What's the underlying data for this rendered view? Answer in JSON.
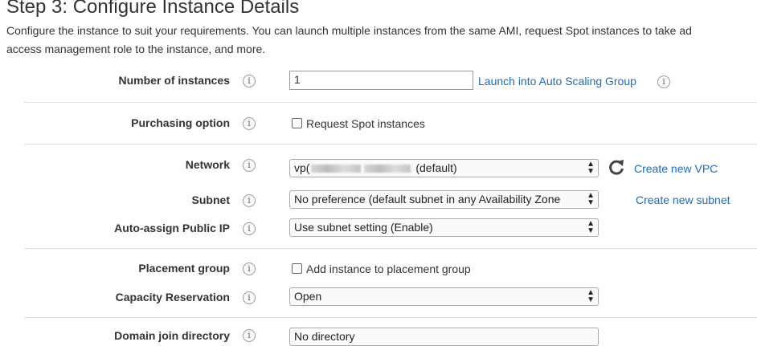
{
  "header": {
    "title": "Step 3: Configure Instance Details",
    "description_line1": "Configure the instance to suit your requirements. You can launch multiple instances from the same AMI, request Spot instances to take ad",
    "description_line2": "access management role to the instance, and more."
  },
  "info_icon_glyph": "i",
  "fields": {
    "number_of_instances": {
      "label": "Number of instances",
      "value": "1",
      "link": "Launch into Auto Scaling Group"
    },
    "purchasing_option": {
      "label": "Purchasing option",
      "checkbox_label": "Request Spot instances",
      "checked": false
    },
    "network": {
      "label": "Network",
      "value_prefix": "vp(",
      "value_suffix": "(default)",
      "link": "Create new VPC"
    },
    "subnet": {
      "label": "Subnet",
      "value": "No preference (default subnet in any Availability Zone",
      "link": "Create new subnet"
    },
    "auto_assign_public_ip": {
      "label": "Auto-assign Public IP",
      "value": "Use subnet setting (Enable)"
    },
    "placement_group": {
      "label": "Placement group",
      "checkbox_label": "Add instance to placement group",
      "checked": false
    },
    "capacity_reservation": {
      "label": "Capacity Reservation",
      "value": "Open"
    },
    "domain_join_directory": {
      "label": "Domain join directory",
      "value": "No directory"
    }
  },
  "icons": {
    "info": "info-icon",
    "refresh": "refresh-icon",
    "dropdown": "select-arrows-icon"
  },
  "colors": {
    "link": "#1f6bb8",
    "text": "#333333",
    "divider": "#e1e1e1"
  }
}
